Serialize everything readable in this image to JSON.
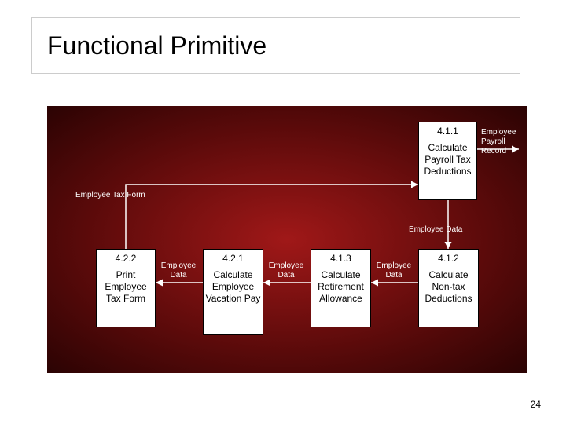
{
  "title": "Functional Primitive",
  "page_number": "24",
  "nodes": {
    "n411": {
      "num": "4.1.1",
      "name": "Calculate Payroll Tax Deductions"
    },
    "n412": {
      "num": "4.1.2",
      "name": "Calculate Non-tax Deductions"
    },
    "n413": {
      "num": "4.1.3",
      "name": "Calculate Retirement Allowance"
    },
    "n421": {
      "num": "4.2.1",
      "name": "Calculate Employee Vacation Pay"
    },
    "n422": {
      "num": "4.2.2",
      "name": "Print Employee Tax Form"
    }
  },
  "flows": {
    "employee_tax_form": "Employee  Tax Form",
    "employee_payroll_record": "Employee Payroll Record",
    "employee_data_1": "Employee  Data",
    "employee_data_2": "Employee Data",
    "employee_data_3": "Employee Data",
    "employee_data_4": "Employee Data"
  }
}
